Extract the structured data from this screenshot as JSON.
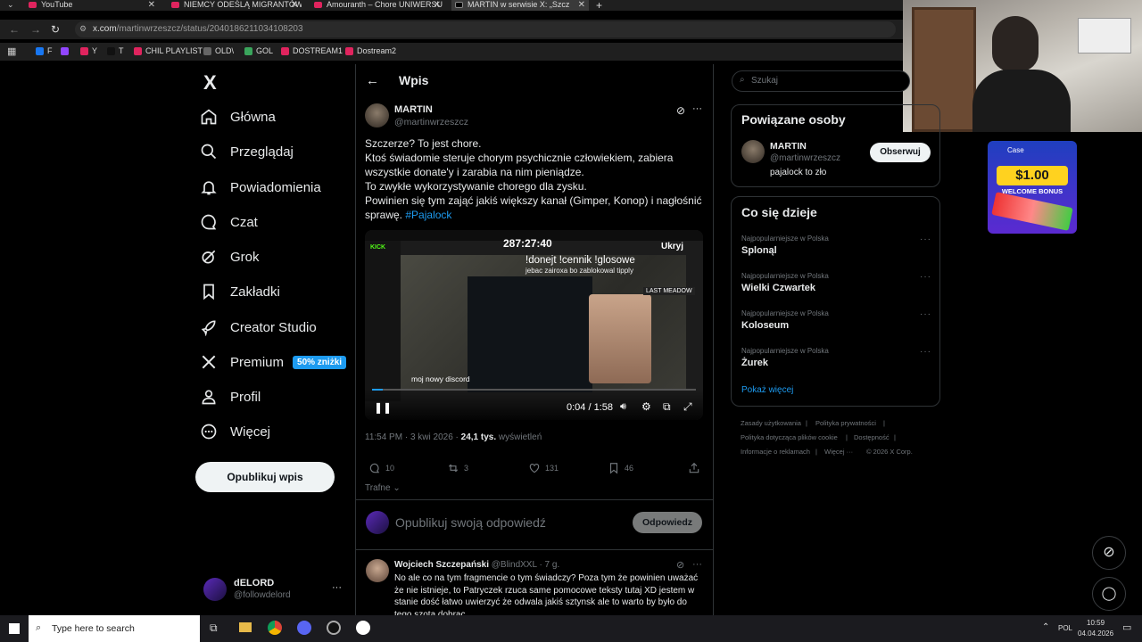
{
  "browser": {
    "tabs": [
      {
        "label": "YouTube"
      },
      {
        "label": "NIEMCY ODEŚLĄ MIGRANTÓW"
      },
      {
        "label": "Amouranth – Chore UNIWERSU"
      },
      {
        "label": "MARTIN w serwisie X: „Szcz"
      }
    ],
    "url_host": "x.com",
    "url_path": "/martinwrzeszcz/status/2040186211034108203",
    "bookmarks": [
      {
        "label": "F",
        "color": "#1877f2"
      },
      {
        "label": "",
        "color": "#9146ff"
      },
      {
        "label": "Y",
        "color": "#e0245e"
      },
      {
        "label": "T",
        "color": "#111111"
      },
      {
        "label": "CHIL PLAYLIST",
        "color": "#e0245e"
      },
      {
        "label": "OLD\\",
        "color": "#666666"
      },
      {
        "label": "GOL",
        "color": "#3aa55c"
      },
      {
        "label": "DOSTREAM1",
        "color": "#e0245e"
      },
      {
        "label": "Dostream2",
        "color": "#e0245e"
      }
    ]
  },
  "nav": {
    "logo": "X",
    "items": [
      {
        "label": "Główna",
        "icon": "home-icon"
      },
      {
        "label": "Przeglądaj",
        "icon": "search-icon"
      },
      {
        "label": "Powiadomienia",
        "icon": "bell-icon"
      },
      {
        "label": "Czat",
        "icon": "chat-icon"
      },
      {
        "label": "Grok",
        "icon": "grok-icon"
      },
      {
        "label": "Zakładki",
        "icon": "bookmark-icon"
      },
      {
        "label": "Creator Studio",
        "icon": "rocket-icon"
      },
      {
        "label": "Premium",
        "icon": "x-icon"
      },
      {
        "label": "Profil",
        "icon": "person-icon"
      },
      {
        "label": "Więcej",
        "icon": "more-circle-icon"
      }
    ],
    "premium_badge": "50% zniżki",
    "post_button": "Opublikuj wpis",
    "account": {
      "name": "dELORD",
      "handle": "@followdelord"
    }
  },
  "post": {
    "header": "Wpis",
    "author_name": "MARTIN",
    "author_handle": "@martinwrzeszcz",
    "lines": [
      "Szczerze? To jest chore.",
      "Ktoś świadomie steruje chorym psychicznie człowiekiem, zabiera",
      "wszystkie donate'y i zarabia na nim pieniądze.",
      "To zwykłe wykorzystywanie chorego dla zysku.",
      "Powinien się tym zająć jakiś większy kanał (Gimper, Konop) i nagłośnić"
    ],
    "last_line": "sprawę.",
    "hashtag": "#Pajalock",
    "video": {
      "overlay_timer": "287:27:40",
      "overlay_donate": "!donejt !cennik !glosowe",
      "overlay_sub": "jebac zairoxa bo zablokowal tipply",
      "overlay_ukryj": "Ukryj",
      "overlay_last": "LAST MEADOW",
      "overlay_discord": "moj nowy discord",
      "overlay_kick": "KICK",
      "time": "0:04 / 1:58",
      "progress": 0.034
    },
    "meta_time": "11:54 PM · 3 kwi 2026 · ",
    "meta_views": "24,1 tys.",
    "meta_views_label": " wyświetleń",
    "actions": {
      "replies": "10",
      "reposts": "3",
      "likes": "131",
      "bookmarks": "46"
    },
    "sort": "Trafne",
    "reply_placeholder": "Opublikuj swoją odpowiedź",
    "reply_button": "Odpowiedz"
  },
  "comment": {
    "author": "Wojciech Szczepański",
    "handle_time": "@BlindXXL · 7 g.",
    "text": "No ale co na tym fragmencie o tym świadczy? Poza tym że powinien uważać że nie istnieje, to Patryczek rzuca same pomocowe teksty tutaj XD jestem w stanie dość łatwo uwierzyć że odwala jakiś sztynsk ale to warto by było do tego szota dobrac."
  },
  "sidebar": {
    "search_placeholder": "Szukaj",
    "related_title": "Powiązane osoby",
    "related": {
      "name": "MARTIN",
      "handle": "@martinwrzeszcz",
      "bio": "pajalock to zło",
      "follow": "Obserwuj"
    },
    "trends_title": "Co się dzieje",
    "trends": [
      {
        "context": "Najpopularniejsze w Polska",
        "name": "Splonąl"
      },
      {
        "context": "Najpopularniejsze w Polska",
        "name": "Wielki Czwartek"
      },
      {
        "context": "Najpopularniejsze w Polska",
        "name": "Koloseum"
      },
      {
        "context": "Najpopularniejsze w Polska",
        "name": "Żurek"
      }
    ],
    "show_more": "Pokaż więcej",
    "footer": [
      "Zasady użytkowania",
      "Polityka prywatności",
      "Polityka dotycząca plików cookie",
      "Dostępność",
      "Informacje o reklamach",
      "Więcej ···",
      "© 2026 X Corp."
    ]
  },
  "ad": {
    "brand": "Case",
    "amount": "$1.00",
    "text": "WELCOME BONUS"
  },
  "taskbar": {
    "search": "Type here to search",
    "lang": "POL",
    "time": "10:59",
    "date": "04.04.2026"
  }
}
